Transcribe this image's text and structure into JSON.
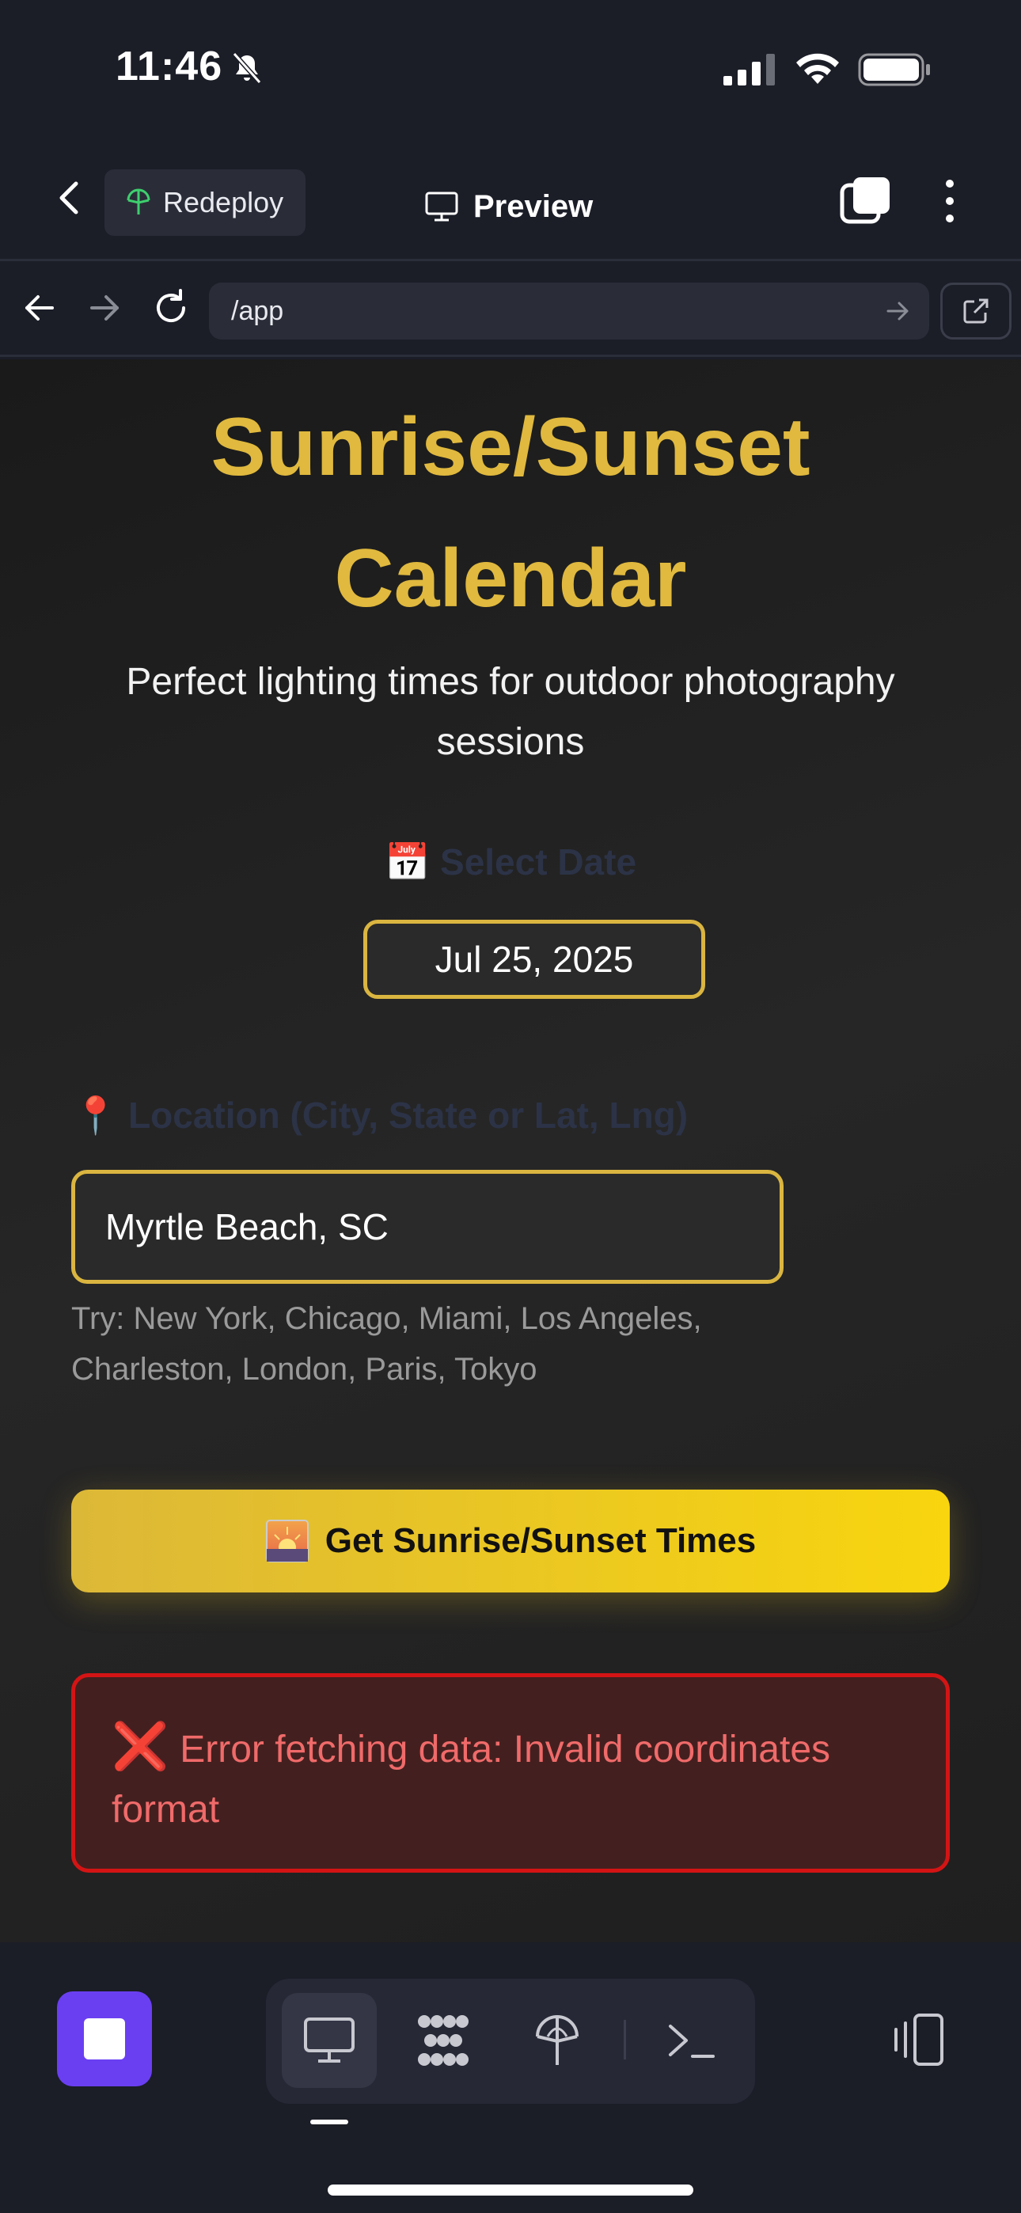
{
  "status_bar": {
    "time": "11:46",
    "icons": [
      "bell-slash-icon",
      "signal-icon",
      "wifi-icon",
      "battery-icon"
    ]
  },
  "top_nav": {
    "redeploy_label": "Redeploy",
    "title": "Preview",
    "icons": [
      "back-icon",
      "antenna-icon",
      "monitor-icon",
      "tabs-icon",
      "more-icon"
    ]
  },
  "url_bar": {
    "url": "/app"
  },
  "app": {
    "title_line1": "Sunrise/Sunset",
    "title_line2": "Calendar",
    "subtitle": "Perfect lighting times for outdoor photography sessions",
    "date_label_emoji": "📅",
    "date_label": "Select Date",
    "date_value": "Jul 25, 2025",
    "location_label_emoji": "📍",
    "location_label": "Location (City, State or Lat, Lng)",
    "location_value": "Myrtle Beach, SC",
    "hint": "Try: New York, Chicago, Miami, Los Angeles, Charleston, London, Paris, Tokyo",
    "button_label": "Get Sunrise/Sunset Times",
    "error_symbol": "❌",
    "error_text": "Error fetching data: Invalid coordinates format"
  },
  "colors": {
    "accent_gold": "#e0b93e",
    "button_gradient_end": "#f8d50e",
    "error_red": "#f06a6a",
    "stop_purple": "#6a3ff2"
  },
  "bottom_bar": {
    "icons": [
      "stop-icon",
      "monitor-icon",
      "apps-icon",
      "antenna-icon",
      "terminal-icon",
      "device-rotate-icon"
    ],
    "active_tab": "monitor"
  }
}
